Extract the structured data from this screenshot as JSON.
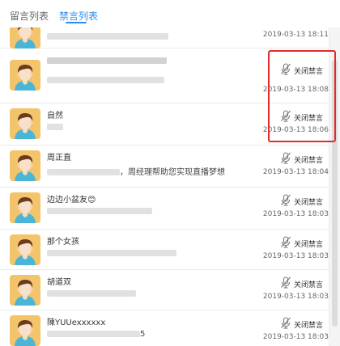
{
  "tabs": [
    {
      "label": "留言列表",
      "active": false
    },
    {
      "label": "禁言列表",
      "active": true
    }
  ],
  "accent_color": "#2d8cf0",
  "highlight_color": "#e32a2a",
  "unmute_label": "关闭禁言",
  "rows": [
    {
      "name": "",
      "message": "",
      "time": "2019-03-13 18:11",
      "message_blur_width": 150,
      "name_blur_width": 0
    },
    {
      "name": "",
      "message": "",
      "time": "2019-03-13 18:08",
      "message_blur_width": 145,
      "name_blur_width": 148
    },
    {
      "name": "自然",
      "message": "",
      "time": "2019-03-13 18:06",
      "message_blur_width": 20,
      "name_blur_width": 0
    },
    {
      "name": "周正直",
      "message": "，周经理帮助您实现直播梦想",
      "time": "2019-03-13 18:04",
      "message_blur_width": 90,
      "name_blur_width": 0
    },
    {
      "name": "边边小盆友😊",
      "message": "",
      "time": "2019-03-13 18:03",
      "message_blur_width": 130,
      "name_blur_width": 0
    },
    {
      "name": "那个女孩",
      "message": "",
      "time": "2019-03-13 18:03",
      "message_blur_width": 160,
      "name_blur_width": 0
    },
    {
      "name": "胡道双",
      "message": "",
      "time": "2019-03-13 18:03",
      "message_blur_width": 110,
      "name_blur_width": 0
    },
    {
      "name": "陳YUUexxxxxx",
      "message": "5",
      "time": "2019-03-13 18:03",
      "message_blur_width": 115,
      "name_blur_width": 0
    }
  ]
}
